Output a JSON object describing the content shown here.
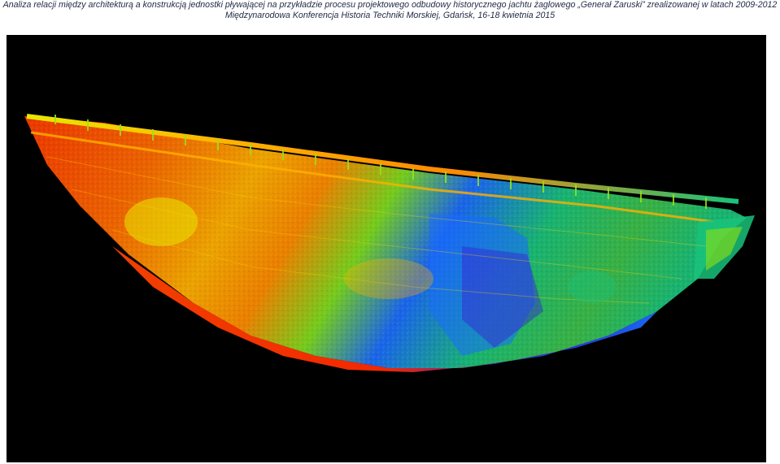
{
  "header": {
    "line1": "Analiza relacji między architekturą a konstrukcją jednostki pływającej na przykładzie procesu projektowego odbudowy historycznego jachtu żaglowego „Generał Zaruski” zrealizowanej w latach 2009-2012",
    "line2": "Międzynarodowa Konferencja Historia Techniki Morskiej, Gdańsk, 16-18 kwietnia 2015"
  },
  "figure": {
    "background": "#000000",
    "palette": [
      "#ff2a00",
      "#ff6a00",
      "#ffb000",
      "#e8e800",
      "#7ddc1f",
      "#19c27a",
      "#1a6cff",
      "#3a1fd6"
    ]
  }
}
